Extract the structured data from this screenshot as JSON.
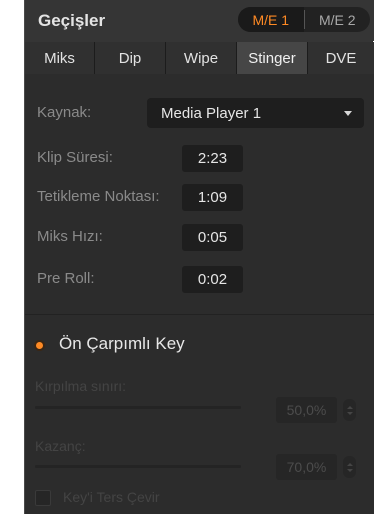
{
  "header": {
    "title": "Geçişler"
  },
  "me_buttons": [
    {
      "label": "M/E 1"
    },
    {
      "label": "M/E 2"
    }
  ],
  "colors": {
    "accent": "#ff8a24",
    "panel": "#353535",
    "content": "#2c2c2c"
  },
  "tabs": [
    {
      "label": "Miks"
    },
    {
      "label": "Dip"
    },
    {
      "label": "Wipe"
    },
    {
      "label": "Stinger"
    },
    {
      "label": "DVE"
    }
  ],
  "stinger": {
    "source_label": "Kaynak:",
    "source_value": "Media Player 1",
    "clip_duration_label": "Klip Süresi:",
    "clip_duration_value": "2:23",
    "trigger_point_label": "Tetikleme Noktası:",
    "trigger_point_value": "1:09",
    "mix_rate_label": "Miks Hızı:",
    "mix_rate_value": "0:05",
    "pre_roll_label": "Pre Roll:",
    "pre_roll_value": "0:02"
  },
  "key": {
    "premultiplied_label": "Ön Çarpımlı Key",
    "clip_label": "Kırpılma sınırı:",
    "clip_value": "50,0%",
    "gain_label": "Kazanç:",
    "gain_value": "70,0%",
    "invert_label": "Key'i Ters Çevir"
  },
  "icons": [
    "chevron-down-icon",
    "radio-selected-icon",
    "stepper-icon",
    "checkbox-icon"
  ]
}
